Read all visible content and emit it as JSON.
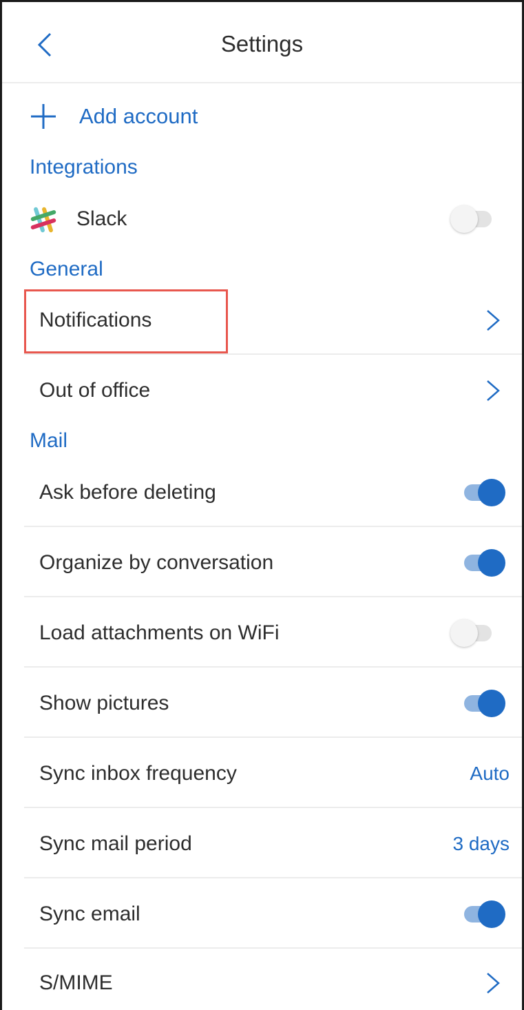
{
  "header": {
    "title": "Settings",
    "back_icon": "chevron-left-icon"
  },
  "add_account": {
    "label": "Add account",
    "icon": "plus-icon"
  },
  "sections": {
    "integrations": "Integrations",
    "general": "General",
    "mail": "Mail"
  },
  "integrations": {
    "slack": {
      "label": "Slack",
      "enabled": false,
      "icon": "slack-icon"
    }
  },
  "general": {
    "notifications": "Notifications",
    "out_of_office": "Out of office"
  },
  "mail": {
    "ask_before_deleting": {
      "label": "Ask before deleting",
      "enabled": true
    },
    "organize_by_conversation": {
      "label": "Organize by conversation",
      "enabled": true
    },
    "load_attachments": {
      "label": "Load attachments on WiFi",
      "enabled": false
    },
    "show_pictures": {
      "label": "Show pictures",
      "enabled": true
    },
    "sync_inbox_frequency": {
      "label": "Sync inbox frequency",
      "value": "Auto"
    },
    "sync_mail_period": {
      "label": "Sync mail period",
      "value": "3 days"
    },
    "sync_email": {
      "label": "Sync email",
      "enabled": true
    },
    "smime": {
      "label": "S/MIME"
    }
  },
  "colors": {
    "accent": "#1f6bc4",
    "highlight": "#e8574e",
    "divider": "#ececec"
  }
}
